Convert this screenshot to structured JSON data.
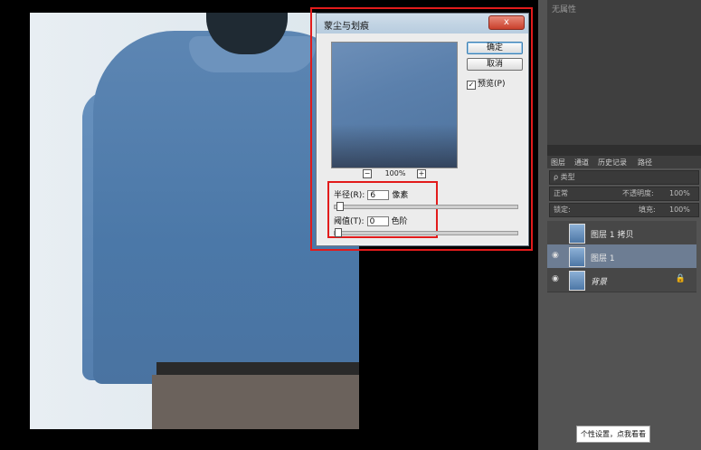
{
  "dialog": {
    "title": "蒙尘与划痕",
    "close": "x",
    "ok": "确定",
    "cancel": "取消",
    "preview_check": "✓",
    "preview_label": "预览(P)",
    "zoom_minus": "−",
    "zoom_plus": "+",
    "zoom": "100%",
    "radius_label": "半径(R):",
    "radius_value": "6",
    "radius_unit": "像素",
    "threshold_label": "阈值(T):",
    "threshold_value": "0",
    "threshold_unit": "色阶"
  },
  "panel": {
    "top_label": "无属性",
    "tabs": [
      "图层",
      "通道",
      "历史记录",
      "路径"
    ],
    "filter": "ρ 类型",
    "blend": "正常",
    "opacity_label": "不透明度:",
    "opacity": "100%",
    "lock_label": "锁定:",
    "fill_label": "填充:",
    "fill": "100%",
    "eye": "◉",
    "lock_icon": "🔒",
    "layers": [
      {
        "name": "图层 1 拷贝"
      },
      {
        "name": "图层 1"
      },
      {
        "name": "背景"
      }
    ]
  },
  "tooltip": "个性设置，点我看看"
}
